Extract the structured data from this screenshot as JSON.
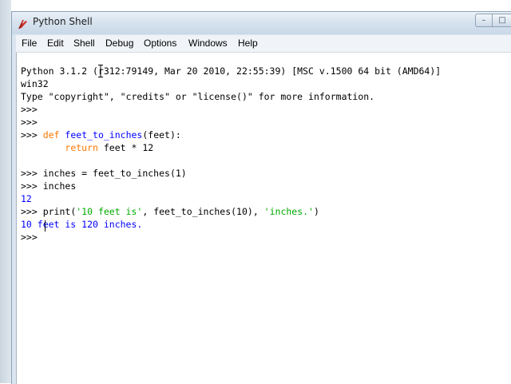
{
  "window": {
    "title": "Python Shell",
    "controls": {
      "minimize": "–",
      "maximize": "□"
    }
  },
  "menubar": {
    "items": [
      "File",
      "Edit",
      "Shell",
      "Debug",
      "Options",
      "Windows",
      "Help"
    ]
  },
  "shell": {
    "banner_line1": "Python 3.1.2 (r312:79149, Mar 20 2010, 22:55:39) [MSC v.1500 64 bit (AMD64)]",
    "banner_line2": "win32",
    "banner_line3": "Type \"copyright\", \"credits\" or \"license()\" for more information.",
    "prompt": ">>> ",
    "def_keyword": "def",
    "def_name": "feet_to_inches",
    "def_rest": "(feet):",
    "return_indent": "        ",
    "return_keyword": "return",
    "return_rest": " feet * 12",
    "assign_line": "inches = feet_to_inches(1)",
    "eval_line": "inches",
    "eval_output": "12",
    "print_call_start": "print(",
    "print_str1": "'10 feet is'",
    "print_mid": ", feet_to_inches(10), ",
    "print_str2": "'inches.'",
    "print_close": ")",
    "print_output": "10 feet is 120 inches."
  }
}
